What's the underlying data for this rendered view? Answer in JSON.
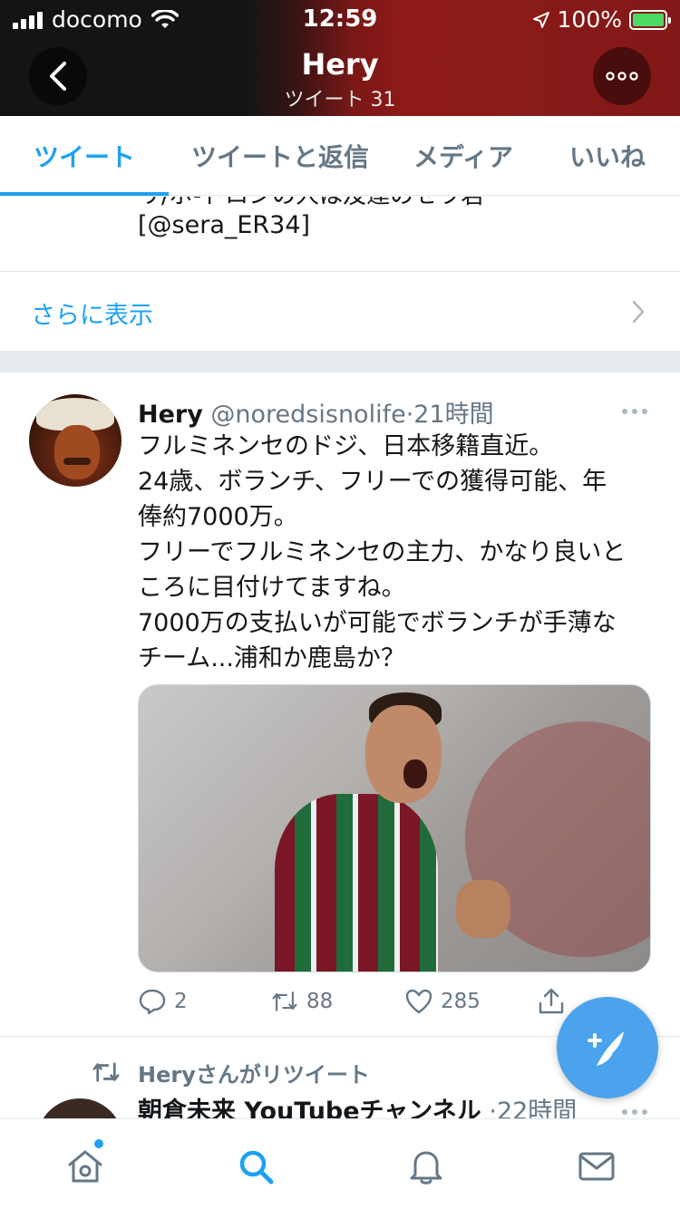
{
  "status_bar": {
    "carrier": "docomo",
    "time": "12:59",
    "battery_percent": "100%"
  },
  "header": {
    "profile_name": "Hery",
    "tweet_count": "ツイート 31"
  },
  "tabs": [
    {
      "label": "ツイート",
      "active": true
    },
    {
      "label": "ツイートと返信",
      "active": false
    },
    {
      "label": "メディア",
      "active": false
    },
    {
      "label": "いいね",
      "active": false
    }
  ],
  "previous_tweet": {
    "cut_line": "リ/ボ-ドロンの人は及達のセラ君",
    "handle_line": "[@sera_ER34]"
  },
  "show_more": {
    "label": "さらに表示"
  },
  "tweet": {
    "name": "Hery",
    "handle": "@noredsisnolife",
    "separator": "·",
    "time": "21時間",
    "text_lines": [
      "フルミネンセのドジ、日本移籍直近。",
      "24歳、ボランチ、フリーでの獲得可能、年",
      "俸約7000万。",
      "フリーでフルミネンセの主力、かなり良いと",
      "ころに目付けてますね。",
      "7000万の支払いが可能でボランチが手薄な",
      "チーム...浦和か鹿島か？"
    ],
    "replies": "2",
    "retweets": "88",
    "likes": "285"
  },
  "retweeted_tweet": {
    "retweet_label": "Heryさんがリツイート",
    "name": "朝倉未来 YouTubeチャンネル",
    "separator": "·",
    "time": "22時間"
  },
  "colors": {
    "accent": "#1da1f2",
    "fab": "#4aa3ec",
    "header_dark": "#141414",
    "header_red": "#8e1a18"
  },
  "icons": {
    "tab_home": "home-icon",
    "tab_search": "search-icon",
    "tab_notifications": "bell-icon",
    "tab_messages": "mail-icon",
    "fab": "compose-tweet-icon"
  }
}
